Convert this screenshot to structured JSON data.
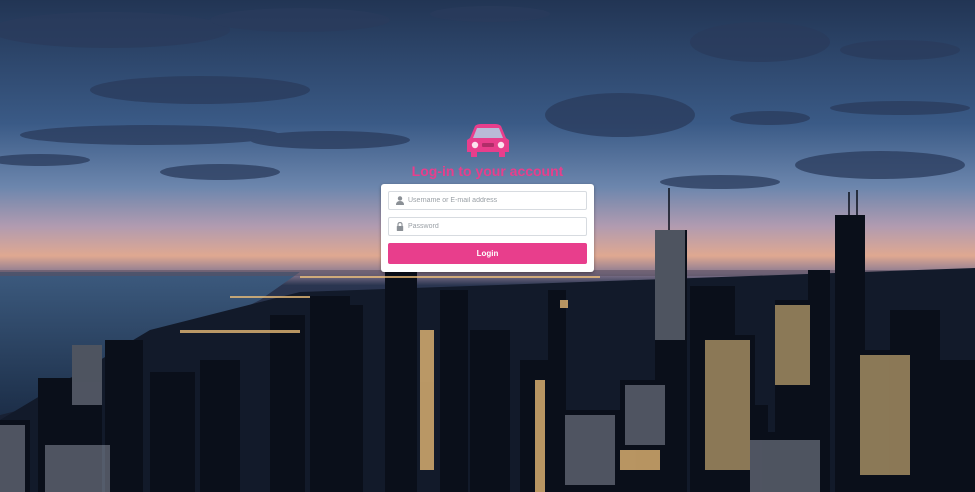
{
  "brand": {
    "icon": "car-icon",
    "title": "Log-in to your account",
    "accent_color": "#e83e8c"
  },
  "form": {
    "username": {
      "icon": "user-icon",
      "placeholder": "Username or E-mail address",
      "value": ""
    },
    "password": {
      "icon": "lock-icon",
      "placeholder": "Password",
      "value": ""
    },
    "login_label": "Login"
  },
  "background": {
    "description_icon": "city-skyline-background"
  }
}
